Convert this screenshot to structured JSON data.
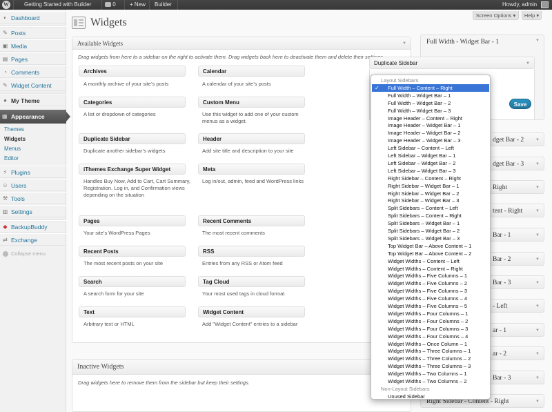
{
  "admin_bar": {
    "site_name": "Getting Started with Builder",
    "comments_count": "0",
    "new_label": "+ New",
    "builder_label": "Builder",
    "howdy": "Howdy, admin"
  },
  "menu": {
    "items_top": [
      {
        "label": "Dashboard",
        "icon": "dashboard-icon"
      },
      {
        "label": "Posts",
        "icon": "pin-icon"
      },
      {
        "label": "Media",
        "icon": "media-icon"
      },
      {
        "label": "Pages",
        "icon": "page-icon"
      },
      {
        "label": "Comments",
        "icon": "comment-icon"
      },
      {
        "label": "Widget Content",
        "icon": "widget-content-icon"
      }
    ],
    "my_theme": "My Theme",
    "appearance": "Appearance",
    "submenu": [
      "Themes",
      "Widgets",
      "Menus",
      "Editor"
    ],
    "items_bottom": [
      {
        "label": "Plugins",
        "icon": "plugin-icon"
      },
      {
        "label": "Users",
        "icon": "users-icon"
      },
      {
        "label": "Tools",
        "icon": "tools-icon"
      },
      {
        "label": "Settings",
        "icon": "settings-icon"
      }
    ],
    "backupbuddy": "BackupBuddy",
    "exchange": "Exchange",
    "collapse": "Collapse menu"
  },
  "header": {
    "title": "Widgets",
    "screen_options": "Screen Options ▾",
    "help": "Help ▾"
  },
  "available": {
    "title": "Available Widgets",
    "description": "Drag widgets from here to a sidebar on the right to activate them. Drag widgets back here to deactivate them and delete their settings.",
    "widgets": [
      {
        "name": "Archives",
        "desc": "A monthly archive of your site’s posts"
      },
      {
        "name": "Calendar",
        "desc": "A calendar of your site’s posts"
      },
      {
        "name": "Categories",
        "desc": "A list or dropdown of categories"
      },
      {
        "name": "Custom Menu",
        "desc": "Use this widget to add one of your custom menus as a widget."
      },
      {
        "name": "Duplicate Sidebar",
        "desc": "Duplicate another sidebar’s widgets"
      },
      {
        "name": "Header",
        "desc": "Add site title and description to your site"
      },
      {
        "name": "iThemes Exchange Super Widget",
        "desc": "Handles Buy Now, Add to Cart, Cart Summary, Registration, Log in, and Confirmation views depending on the situation"
      },
      {
        "name": "Meta",
        "desc": "Log in/out, admin, feed and WordPress links"
      },
      {
        "name": "Pages",
        "desc": "Your site’s WordPress Pages"
      },
      {
        "name": "Recent Comments",
        "desc": "The most recent comments"
      },
      {
        "name": "Recent Posts",
        "desc": "The most recent posts on your site"
      },
      {
        "name": "RSS",
        "desc": "Entries from any RSS or Atom feed"
      },
      {
        "name": "Search",
        "desc": "A search form for your site"
      },
      {
        "name": "Tag Cloud",
        "desc": "Your most used tags in cloud format"
      },
      {
        "name": "Text",
        "desc": "Arbitrary text or HTML"
      },
      {
        "name": "Widget Content",
        "desc": "Add \"Widget Content\" entries to a sidebar"
      }
    ]
  },
  "inactive": {
    "title": "Inactive Widgets",
    "description": "Drag widgets here to remove them from the sidebar but keep their settings."
  },
  "sidebars": {
    "main_title": "Full Width - Widget Bar - 1",
    "dup_widget_title": "Duplicate Sidebar",
    "save": "Save",
    "collapsed": [
      "Full Width - Widget Bar - 2",
      "Full Width - Widget Bar - 3",
      "Image Header - Content - Right",
      "Image Header - Content - Right",
      "Image Header - Widget Bar - 1",
      "Image Header - Widget Bar - 2",
      "Image Header - Widget Bar - 3",
      "Left Sidebar - Content - Left",
      "Left Sidebar - Widget Bar - 1",
      "Left Sidebar - Widget Bar - 2",
      "Left Sidebar - Widget Bar - 3",
      "Right Sidebar - Content - Right"
    ],
    "collapsed_visible": [
      "dget Bar - 2",
      "dget Bar - 3",
      "Right",
      "tent - Right",
      "Bar - 1",
      "Bar - 2",
      "Bar - 3",
      "- Left",
      "ar - 1",
      "ar - 2",
      "Bar - 3",
      "Right Sidebar - Content - Right"
    ]
  },
  "dropdown": {
    "group_layout": "Layout Sidebars",
    "group_non_layout": "Non-Layout Sidebars",
    "selected": "Full Width – Content – Right",
    "layout_options": [
      "Full Width – Content – Right",
      "Full Width – Widget Bar – 1",
      "Full Width – Widget Bar – 2",
      "Full Width – Widget Bar – 3",
      "Image Header – Content – Right",
      "Image Header – Widget Bar – 1",
      "Image Header – Widget Bar – 2",
      "Image Header – Widget Bar – 3",
      "Left Sidebar – Content – Left",
      "Left Sidebar – Widget Bar – 1",
      "Left Sidebar – Widget Bar – 2",
      "Left Sidebar – Widget Bar – 3",
      "Right Sidebar – Content – Right",
      "Right Sidebar – Widget Bar – 1",
      "Right Sidebar – Widget Bar – 2",
      "Right Sidebar – Widget Bar – 3",
      "Split Sidebars – Content – Left",
      "Split Sidebars – Content – Right",
      "Split Sidebars – Widget Bar – 1",
      "Split Sidebars – Widget Bar – 2",
      "Split Sidebars – Widget Bar – 3",
      "Top Widget Bar – Above Content – 1",
      "Top Widget Bar – Above Content – 2",
      "Widget Widths – Content – Left",
      "Widget Widths – Content – Right",
      "Widget Widths – Five Columns – 1",
      "Widget Widths – Five Columns – 2",
      "Widget Widths – Five Columns – 3",
      "Widget Widths – Five Columns – 4",
      "Widget Widths – Five Columns – 5",
      "Widget Widths – Four Columns – 1",
      "Widget Widths – Four Columns – 2",
      "Widget Widths – Four Columns – 3",
      "Widget Widths – Four Columns – 4",
      "Widget Widths – Once Column – 1",
      "Widget Widths – Three Columns – 1",
      "Widget Widths – Three Columns – 2",
      "Widget Widths – Three Columns – 3",
      "Widget Widths – Two Columns – 1",
      "Widget Widths – Two Columns – 2"
    ],
    "non_layout_options": [
      "Unused Sidebar"
    ]
  }
}
